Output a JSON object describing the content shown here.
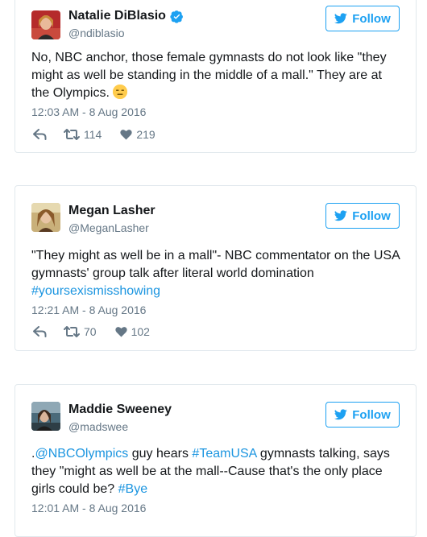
{
  "tweets": [
    {
      "name": "Natalie DiBlasio",
      "handle": "@ndiblasio",
      "verified": true,
      "follow_label": "Follow",
      "text": "No, NBC anchor, those female gymnasts do not look like \"they might as well be standing in the middle of a mall.\" They are at the Olympics.",
      "emoji_icon": "expressionless-face-icon",
      "time": "12:03 AM - 8 Aug 2016",
      "retweets": "114",
      "likes": "219"
    },
    {
      "name": "Megan Lasher",
      "handle": "@MeganLasher",
      "verified": false,
      "follow_label": "Follow",
      "text_prefix": "\"They might as well be in a mall\"- NBC commentator on the USA gymnasts' group talk after literal world domination",
      "hashtag": "#yoursexismisshowing",
      "time": "12:21 AM - 8 Aug 2016",
      "retweets": "70",
      "likes": "102"
    },
    {
      "name": "Maddie Sweeney",
      "handle": "@madswee",
      "verified": false,
      "follow_label": "Follow",
      "text_parts": {
        "p1": ".",
        "mention": "@NBCOlympics",
        "p2": " guy hears ",
        "hashtag1": "#TeamUSA",
        "p3": " gymnasts talking, says they \"might as well be at the mall--Cause that's the only place girls could be? ",
        "hashtag2": "#Bye"
      },
      "time": "12:01 AM - 8 Aug 2016"
    }
  ],
  "colors": {
    "accent": "#1da1f2",
    "link": "#1b95e0",
    "muted": "#657786",
    "text": "#14171a",
    "border": "#e1e8ed"
  }
}
